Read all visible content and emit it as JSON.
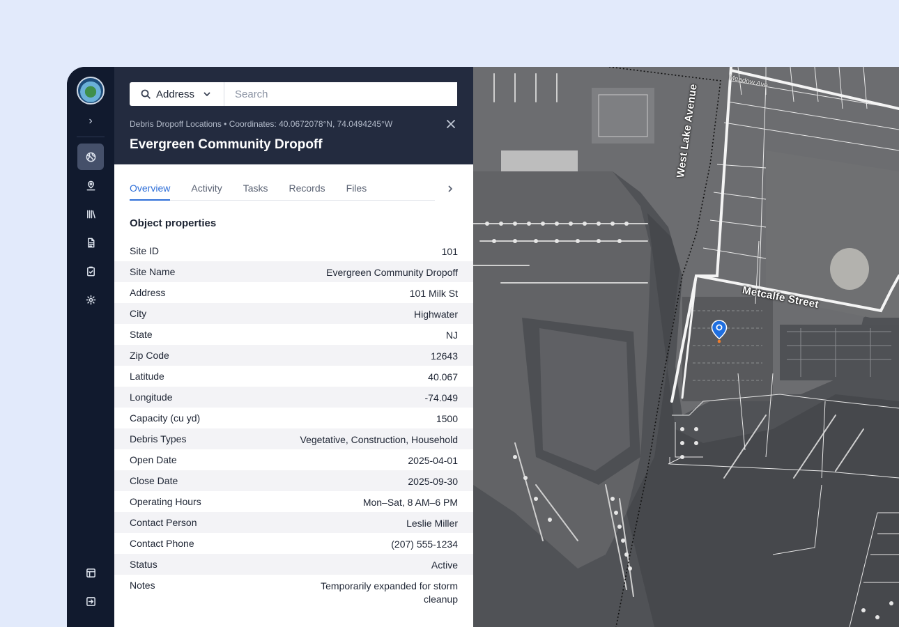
{
  "search": {
    "type_label": "Address",
    "placeholder": "Search",
    "value": ""
  },
  "record": {
    "meta": "Debris Dropoff Locations • Coordinates: 40.0672078°N, 74.0494245°W",
    "title": "Evergreen Community Dropoff"
  },
  "tabs": [
    {
      "label": "Overview",
      "active": true
    },
    {
      "label": "Activity",
      "active": false
    },
    {
      "label": "Tasks",
      "active": false
    },
    {
      "label": "Records",
      "active": false
    },
    {
      "label": "Files",
      "active": false
    }
  ],
  "section_title": "Object properties",
  "properties": [
    {
      "key": "Site ID",
      "value": "101"
    },
    {
      "key": "Site Name",
      "value": "Evergreen Community Dropoff"
    },
    {
      "key": "Address",
      "value": "101 Milk St"
    },
    {
      "key": "City",
      "value": "Highwater"
    },
    {
      "key": "State",
      "value": "NJ"
    },
    {
      "key": "Zip Code",
      "value": "12643"
    },
    {
      "key": "Latitude",
      "value": "40.067"
    },
    {
      "key": "Longitude",
      "value": "-74.049"
    },
    {
      "key": "Capacity (cu yd)",
      "value": "1500"
    },
    {
      "key": "Debris Types",
      "value": "Vegetative, Construction, Household"
    },
    {
      "key": "Open Date",
      "value": "2025-04-01"
    },
    {
      "key": "Close Date",
      "value": "2025-09-30"
    },
    {
      "key": "Operating Hours",
      "value": "Mon–Sat, 8 AM–6 PM"
    },
    {
      "key": "Contact Person",
      "value": "Leslie Miller"
    },
    {
      "key": "Contact Phone",
      "value": "(207) 555-1234"
    },
    {
      "key": "Status",
      "value": "Active"
    },
    {
      "key": "Notes",
      "value": "Temporarily expanded for storm cleanup"
    }
  ],
  "map": {
    "streets": [
      "West Lake Avenue",
      "Metcalfe Street",
      "Meadow Ave"
    ],
    "pin_color": "#1f6fe0"
  },
  "colors": {
    "accent": "#2f6fd8",
    "rail_bg": "#111a2e",
    "header_bg": "#232b3f"
  },
  "icons": {
    "rail": [
      "map-layers-icon",
      "location-user-icon",
      "library-icon",
      "document-icon",
      "clipboard-check-icon",
      "settings-icon",
      "layout-icon",
      "exit-icon"
    ]
  }
}
